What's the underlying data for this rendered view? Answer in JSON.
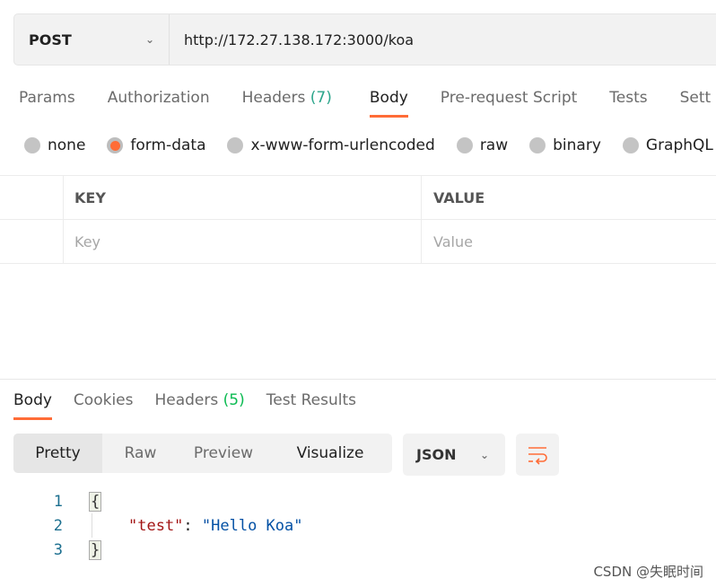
{
  "request": {
    "method": "POST",
    "url": "http://172.27.138.172:3000/koa"
  },
  "request_tabs": [
    {
      "label": "Params"
    },
    {
      "label": "Authorization"
    },
    {
      "label": "Headers",
      "count": "(7)"
    },
    {
      "label": "Body"
    },
    {
      "label": "Pre-request Script"
    },
    {
      "label": "Tests"
    },
    {
      "label": "Sett"
    }
  ],
  "body_types": [
    {
      "label": "none",
      "selected": false
    },
    {
      "label": "form-data",
      "selected": true
    },
    {
      "label": "x-www-form-urlencoded",
      "selected": false
    },
    {
      "label": "raw",
      "selected": false
    },
    {
      "label": "binary",
      "selected": false
    },
    {
      "label": "GraphQL",
      "selected": false
    }
  ],
  "table": {
    "headers": [
      "KEY",
      "VALUE"
    ],
    "placeholders": {
      "key": "Key",
      "value": "Value"
    }
  },
  "response_tabs": [
    {
      "label": "Body"
    },
    {
      "label": "Cookies"
    },
    {
      "label": "Headers",
      "count": "(5)"
    },
    {
      "label": "Test Results"
    }
  ],
  "view_modes": [
    "Pretty",
    "Raw",
    "Preview",
    "Visualize"
  ],
  "format": "JSON",
  "code": {
    "line_numbers": [
      "1",
      "2",
      "3"
    ],
    "open": "{",
    "key": "\"test\"",
    "colon": ": ",
    "value": "\"Hello Koa\"",
    "close": "}"
  },
  "watermark": "CSDN @失眠时间",
  "colors": {
    "accent": "#ff6c37",
    "count": "#0cbb52"
  }
}
